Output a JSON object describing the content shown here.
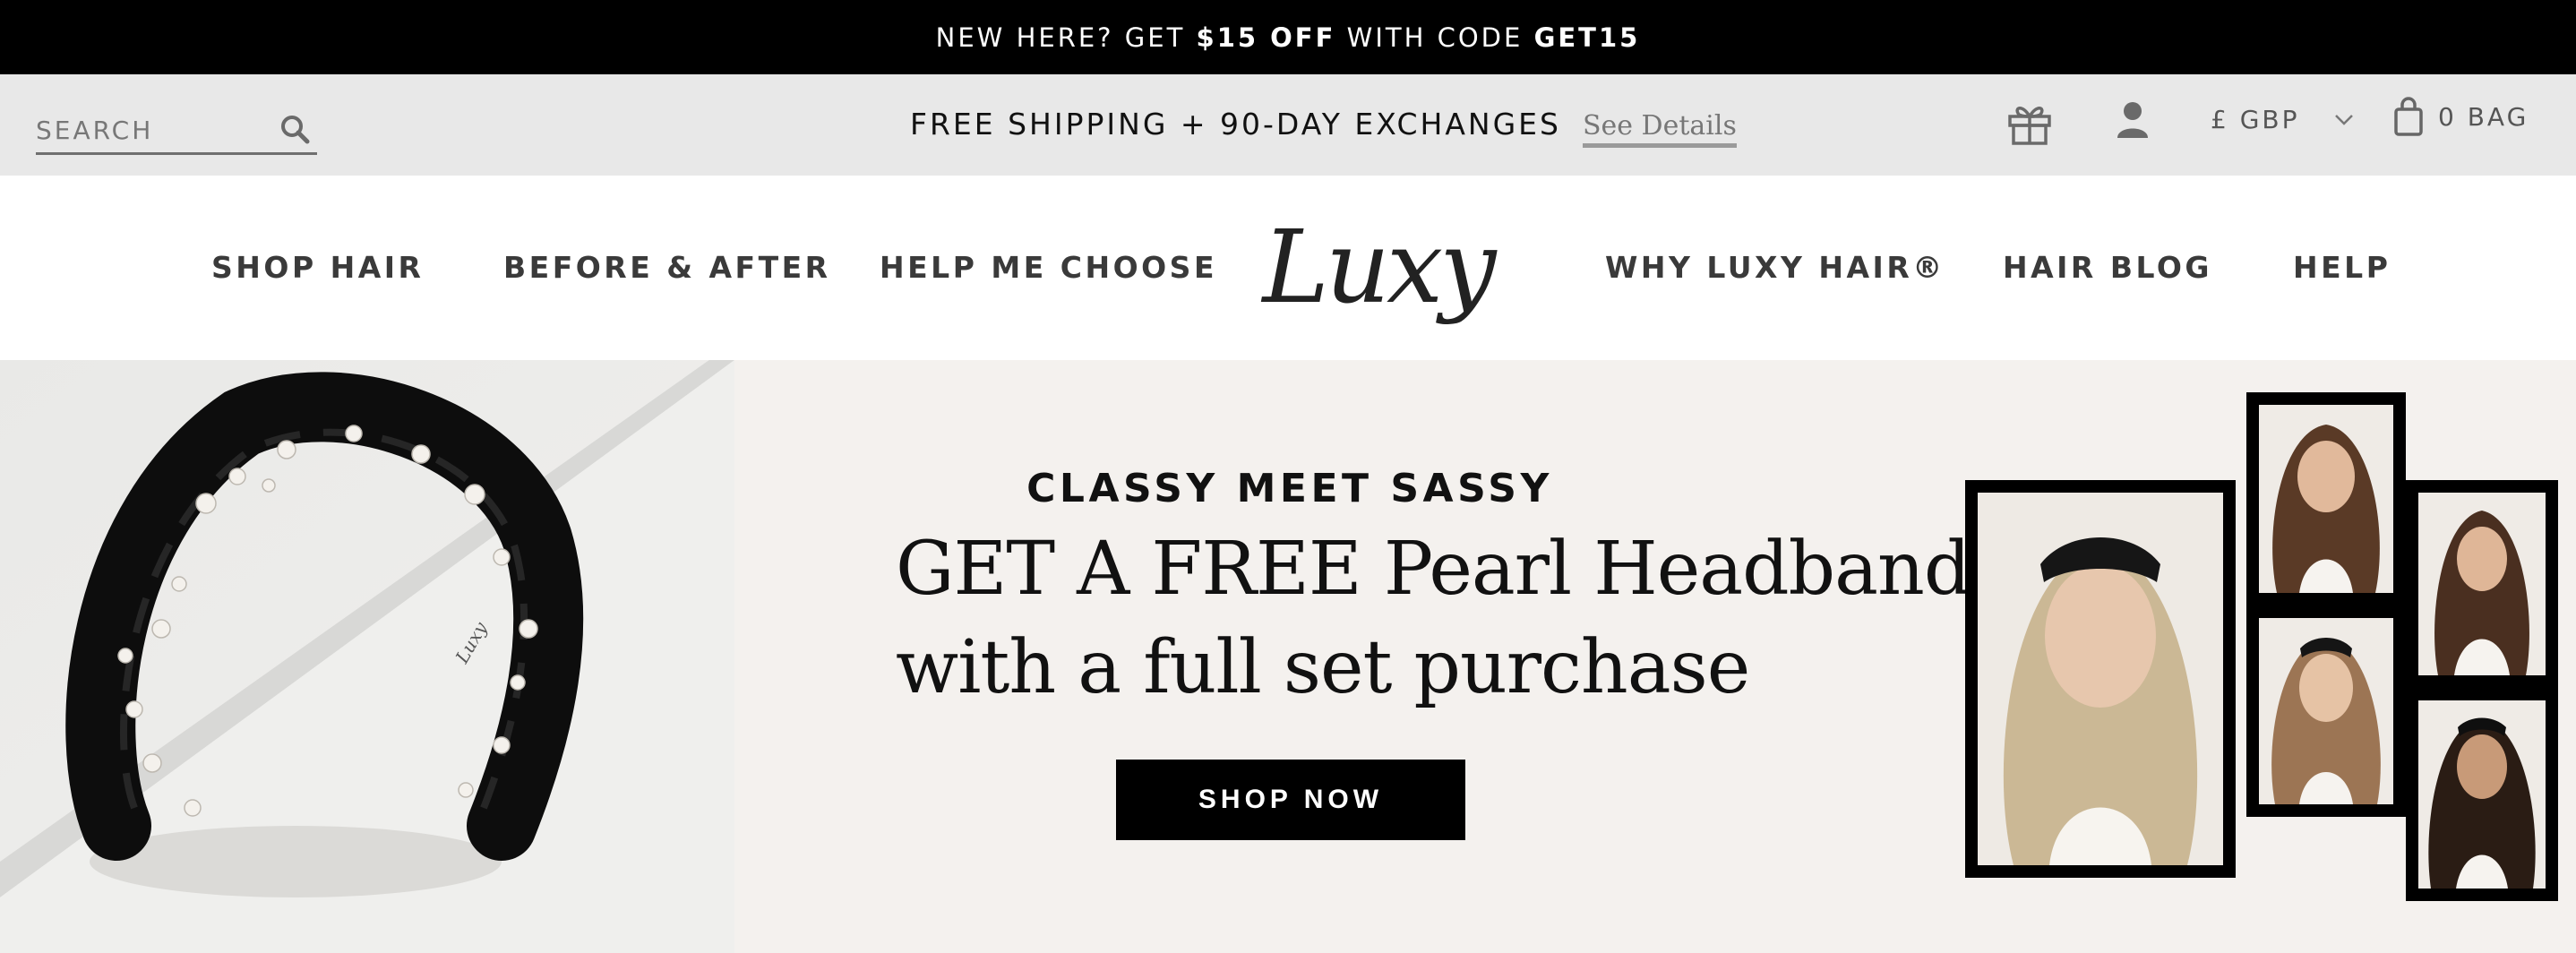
{
  "announcement": {
    "part1": "NEW HERE? GET ",
    "amount": "$15 OFF",
    "part2": " WITH CODE ",
    "code": "GET15"
  },
  "utility": {
    "search_placeholder": "SEARCH",
    "shipping_text": "FREE SHIPPING + 90-DAY EXCHANGES",
    "details_link": "See Details",
    "currency": "£ GBP",
    "bag": "0 BAG",
    "icons": [
      "search-icon",
      "gift-icon",
      "user-icon",
      "chevron-down-icon",
      "shopping-bag-icon"
    ]
  },
  "nav": {
    "items": [
      {
        "label": "SHOP HAIR"
      },
      {
        "label": "BEFORE & AFTER"
      },
      {
        "label": "HELP ME CHOOSE"
      },
      {
        "label": "WHY LUXY HAIR®"
      },
      {
        "label": "HAIR BLOG"
      },
      {
        "label": "HELP"
      }
    ],
    "logo": "Luxy"
  },
  "hero": {
    "eyebrow": "CLASSY MEET SASSY",
    "headline": "GET A FREE Pearl Headband",
    "subline": "with a full set purchase",
    "cta": "SHOP NOW"
  },
  "colors": {
    "announcement_bg": "#000000",
    "utility_bg": "#e8e8e8",
    "hero_bg": "#f4f1ee",
    "cta_bg": "#000000",
    "text": "#111111"
  }
}
